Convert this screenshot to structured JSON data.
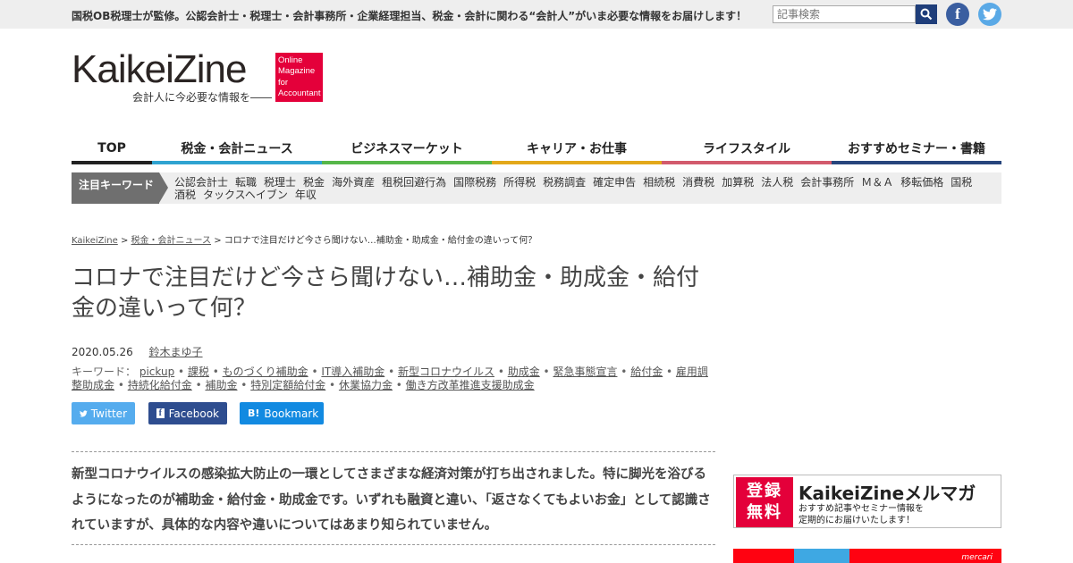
{
  "header": {
    "tagline": "国税OB税理士が監修。公認会計士・税理士・会計事務所・企業経理担当、税金・会計に関わる“会計人”がいま必要な情報をお届けします！",
    "search_placeholder": "記事検索",
    "search_icon": "search-icon",
    "social": [
      {
        "name": "facebook",
        "glyph": "f"
      },
      {
        "name": "twitter",
        "glyph": "t"
      }
    ]
  },
  "logo": {
    "main": "KaikeiZine",
    "subtitle": "会計人に今必要な情報を――",
    "badge_lines": [
      "Online",
      "Magazine",
      "for",
      "Accountant"
    ],
    "badge_color": "#e4003a"
  },
  "nav": [
    {
      "label": "TOP",
      "color": "#222222"
    },
    {
      "label": "税金・会計ニュース",
      "color": "#2fa3d1"
    },
    {
      "label": "ビジネスマーケット",
      "color": "#56b749"
    },
    {
      "label": "キャリア・お仕事",
      "color": "#e3a81a"
    },
    {
      "label": "ライフスタイル",
      "color": "#d25a6c"
    },
    {
      "label": "おすすめセミナー・書籍",
      "color": "#27457c"
    }
  ],
  "keywords_bar": {
    "label": "注目キーワード",
    "items": [
      "公認会計士",
      "転職",
      "税理士",
      "税金",
      "海外資産",
      "租税回避行為",
      "国際税務",
      "所得税",
      "税務調査",
      "確定申告",
      "相続税",
      "消費税",
      "加算税",
      "法人税",
      "会計事務所",
      "Ｍ＆Ａ",
      "移転価格",
      "国税",
      "酒税",
      "タックスヘイブン",
      "年収"
    ]
  },
  "breadcrumb": {
    "home": "KaikeiZine",
    "sep": " > ",
    "category": "税金・会計ニュース",
    "current": "コロナで注目だけど今さら聞けない…補助金・助成金・給付金の違いって何？"
  },
  "article": {
    "title": "コロナで注目だけど今さら聞けない…補助金・助成金・給付金の違いって何？",
    "date": "2020.05.26",
    "author": "鈴木まゆ子",
    "keywords_label": "キーワード：",
    "keywords": [
      "pickup",
      "課税",
      "ものづくり補助金",
      "IT導入補助金",
      "新型コロナウイルス",
      "助成金",
      "緊急事態宣言",
      "給付金",
      "雇用調整助成金",
      "持続化給付金",
      "補助金",
      "特別定額給付金",
      "休業協力金",
      "働き方改革推進支援助成金"
    ],
    "share": {
      "twitter": "Twitter",
      "facebook": "Facebook",
      "hatena": "Bookmark",
      "hatena_icon": "B!"
    },
    "lead": "新型コロナウイルスの感染拡大防止の一環としてさまざまな経済対策が打ち出されました。特に脚光を浴びるようになったのが補助金・給付金・助成金です。いずれも融資と違い、「返さなくてもよいお金」として認識されていますが、具体的な内容や違いについてはあまり知られていません。"
  },
  "sidebar": {
    "mailmag": {
      "badge": "登録\n無料",
      "title": "KaikeiZineメルマガ",
      "sub_line1": "おすすめ記事やセミナー情報を",
      "sub_line2": "定期的にお届けいたします！"
    },
    "ad": {
      "brand": "mercari"
    }
  }
}
